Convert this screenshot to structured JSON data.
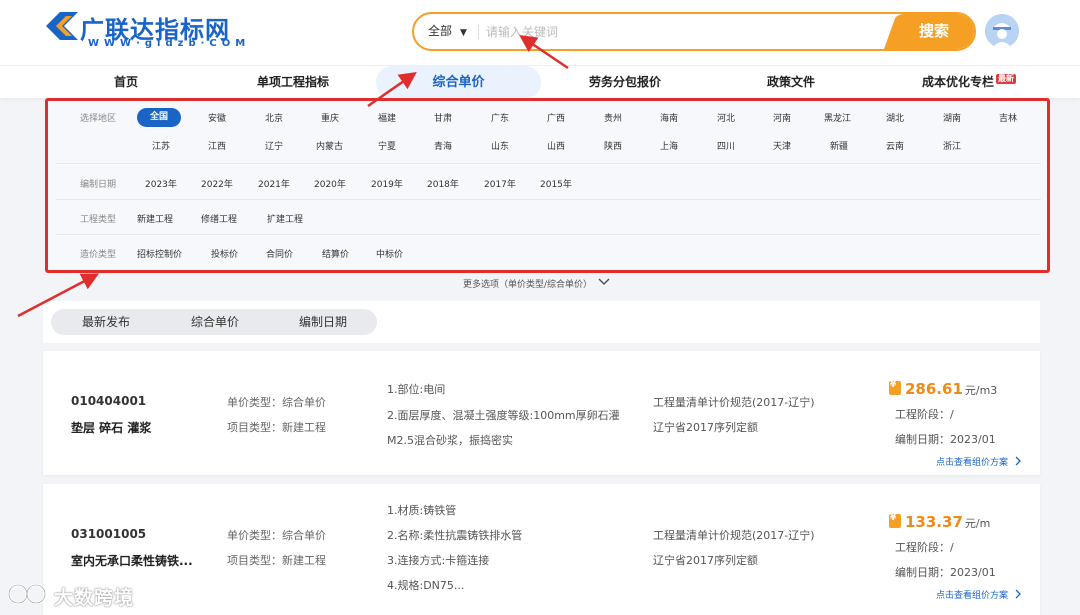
{
  "brand": {
    "name": "广联达指标网",
    "url_text": "WWW·gldzb·COM",
    "colors": {
      "primary": "#1a64c8",
      "accent": "#f5a024",
      "highlight": "#e02e2e"
    }
  },
  "search": {
    "scope": "全部",
    "placeholder": "请输入关键词",
    "button": "搜索",
    "icons": {
      "caret": "caret-down-icon"
    }
  },
  "nav": {
    "items": [
      {
        "label": "首页"
      },
      {
        "label": "单项工程指标"
      },
      {
        "label": "综合单价",
        "active": true
      },
      {
        "label": "劳务分包报价"
      },
      {
        "label": "政策文件"
      },
      {
        "label": "成本优化专栏",
        "badge": "最新"
      }
    ]
  },
  "filters": {
    "region": {
      "label": "选择地区",
      "options": [
        "全国",
        "安徽",
        "北京",
        "重庆",
        "福建",
        "甘肃",
        "广东",
        "广西",
        "贵州",
        "海南",
        "河北",
        "河南",
        "黑龙江",
        "湖北",
        "湖南",
        "吉林",
        "江苏",
        "江西",
        "辽宁",
        "内蒙古",
        "宁夏",
        "青海",
        "山东",
        "山西",
        "陕西",
        "上海",
        "四川",
        "天津",
        "新疆",
        "云南",
        "浙江"
      ],
      "selected": "全国"
    },
    "date": {
      "label": "编制日期",
      "options": [
        "2023年",
        "2022年",
        "2021年",
        "2020年",
        "2019年",
        "2018年",
        "2017年",
        "2015年"
      ]
    },
    "project_type": {
      "label": "工程类型",
      "options": [
        "新建工程",
        "修缮工程",
        "扩建工程"
      ]
    },
    "price_type": {
      "label": "造价类型",
      "options": [
        "招标控制价",
        "投标价",
        "合同价",
        "结算价",
        "中标价"
      ]
    },
    "more": "更多选项（单价类型/综合单价）"
  },
  "sort": {
    "items": [
      "最新发布",
      "综合单价",
      "编制日期"
    ]
  },
  "results": [
    {
      "code": "010404001",
      "title": "垫层 碎石 灌浆",
      "unit_price_type": "单价类型：综合单价",
      "project_type": "项目类型：新建工程",
      "desc": [
        "1.部位:电间",
        "2.面层厚度、混凝土强度等级:100mm厚卵石灌",
        "M2.5混合砂浆，振捣密实"
      ],
      "norms": [
        "工程量清单计价规范(2017-辽宁)",
        "辽宁省2017序列定额"
      ],
      "price": "286.61",
      "price_unit": "元/m3",
      "stage": "工程阶段：/",
      "date": "编制日期：2023/01",
      "link": "点击查看组价方案"
    },
    {
      "code": "031001005",
      "title": "室内无承口柔性铸铁...",
      "unit_price_type": "单价类型：综合单价",
      "project_type": "项目类型：新建工程",
      "desc": [
        "1.材质:铸铁管",
        "2.名称:柔性抗震铸铁排水管",
        "3.连接方式:卡箍连接",
        "4.规格:DN75..."
      ],
      "norms": [
        "工程量清单计价规范(2017-辽宁)",
        "辽宁省2017序列定额"
      ],
      "price": "133.37",
      "price_unit": "元/m",
      "stage": "工程阶段：/",
      "date": "编制日期：2023/01",
      "link": "点击查看组价方案"
    }
  ],
  "watermark": {
    "text": "大数跨境"
  }
}
